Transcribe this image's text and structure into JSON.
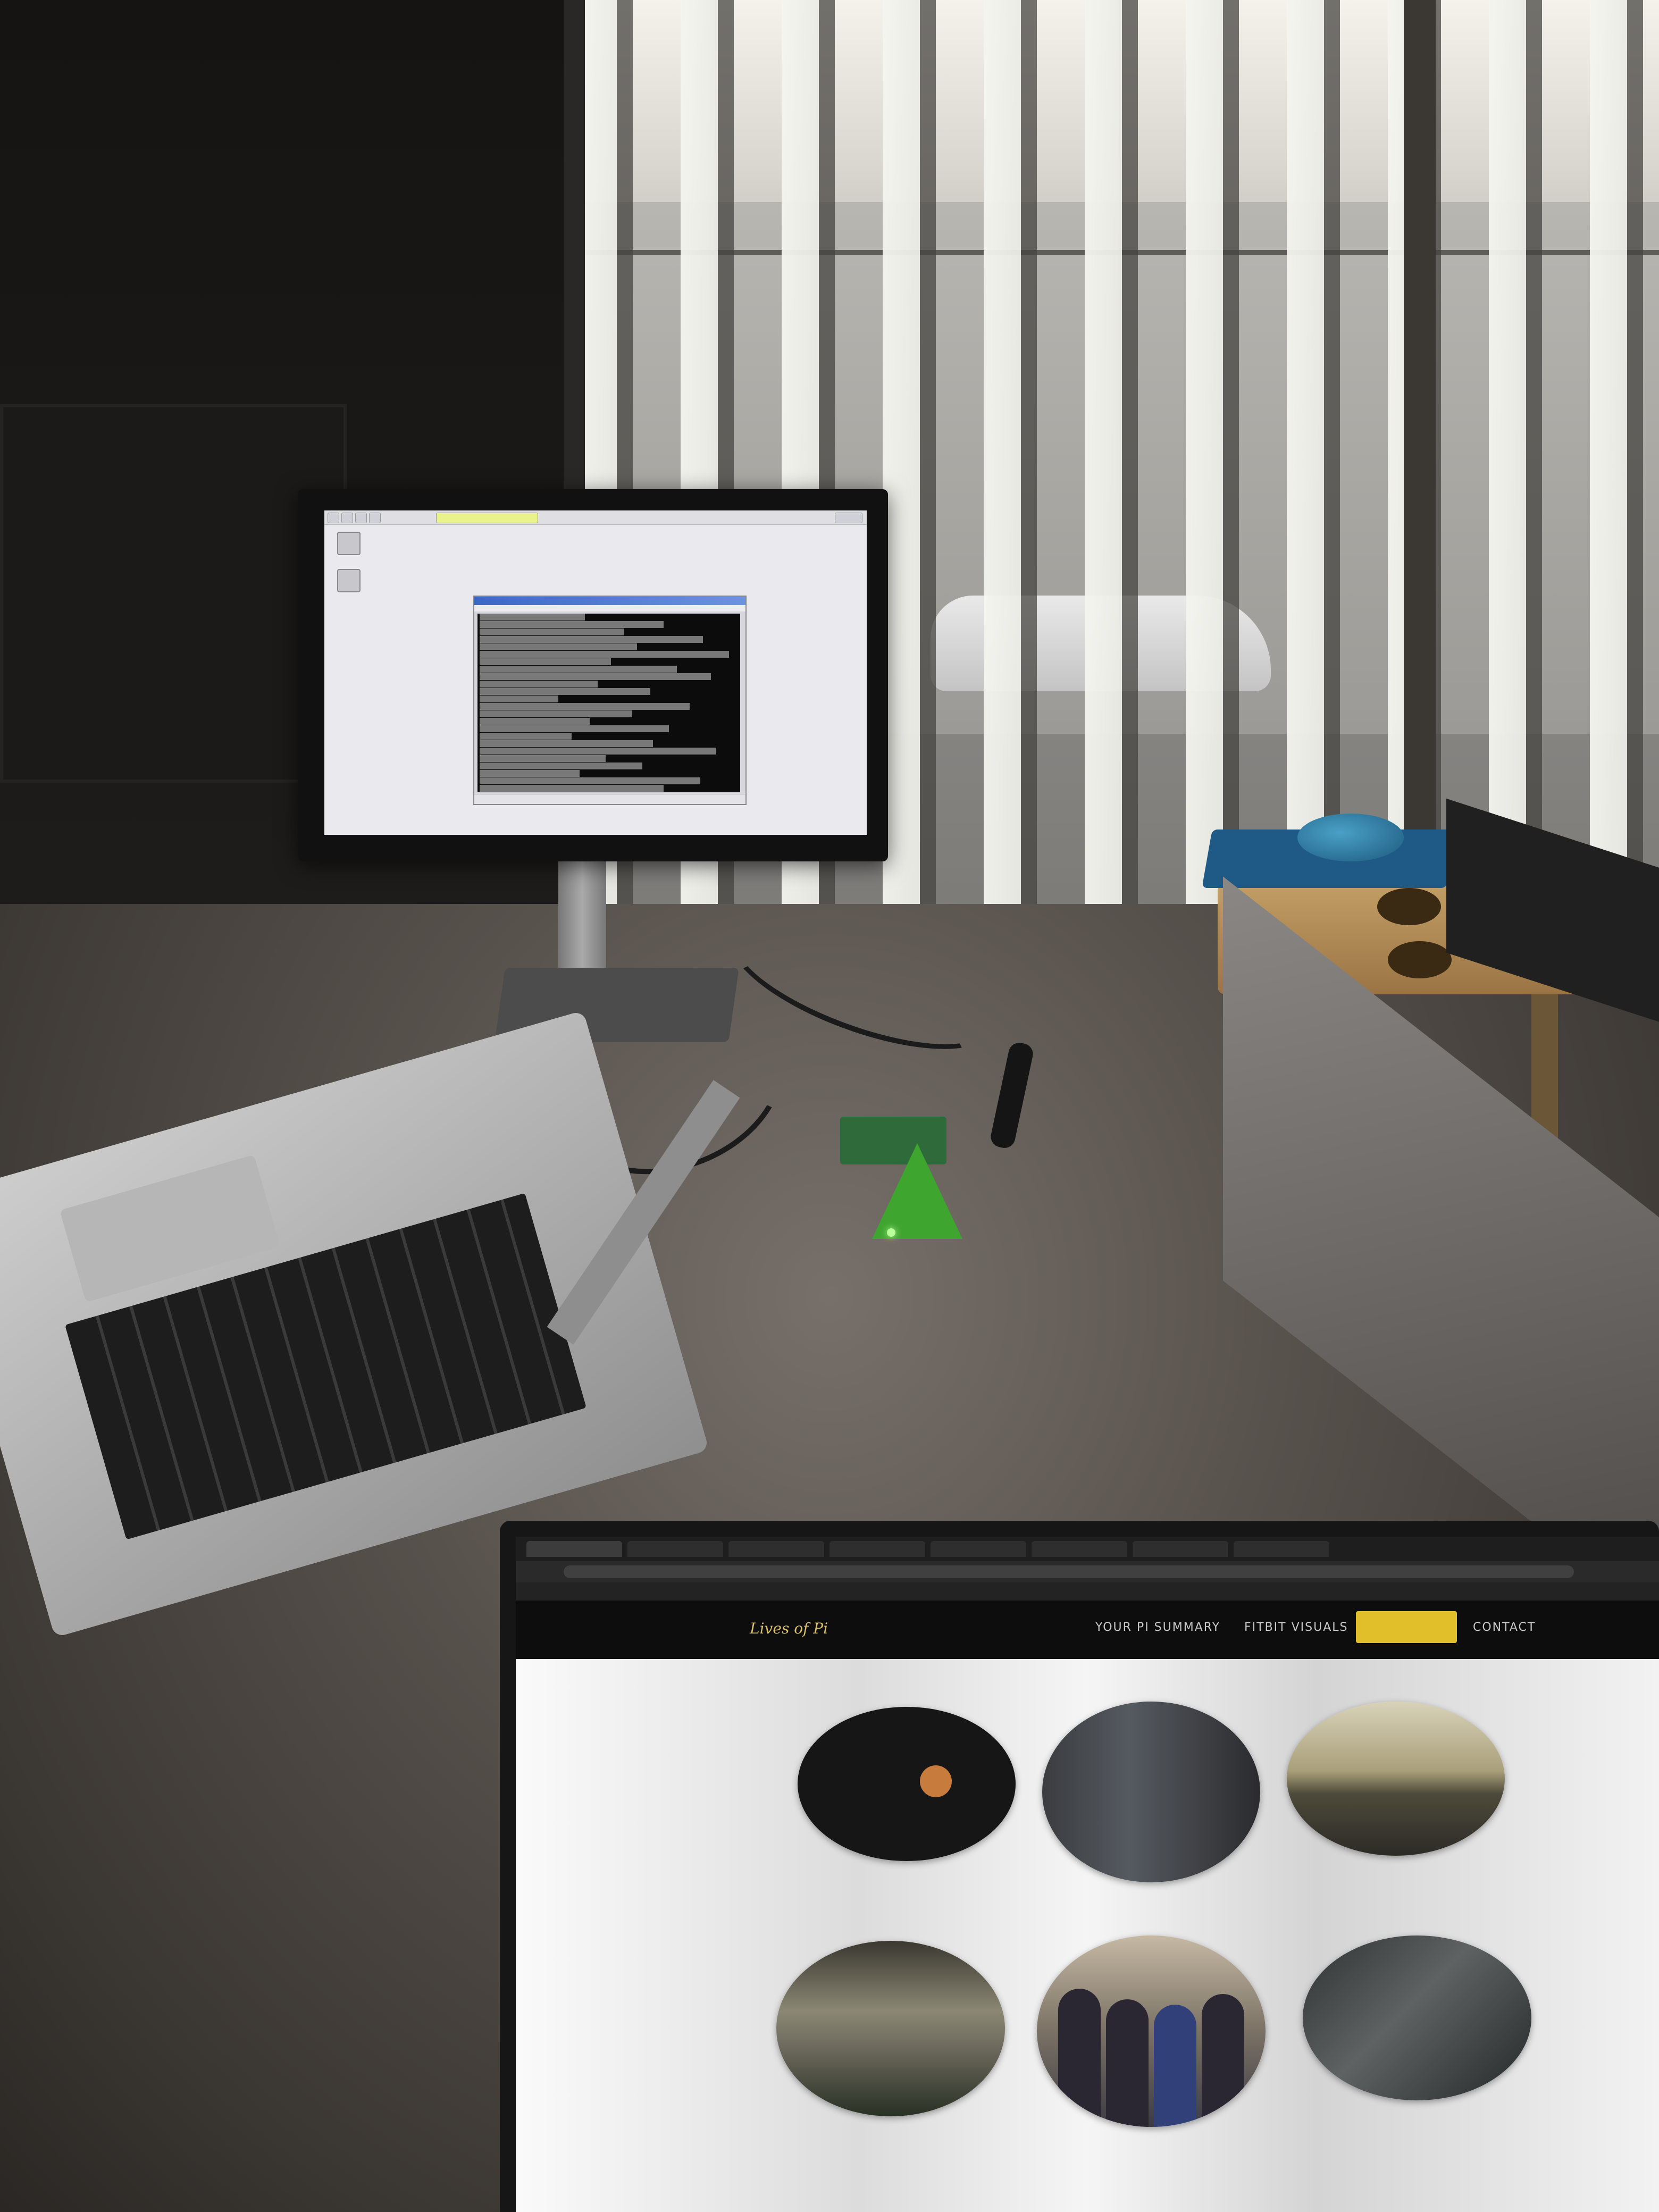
{
  "scene": {
    "description_tag": "",
    "accent_colors": {
      "site_nav_active": "#e0bf2a",
      "pi_case": "#3ea52f",
      "mousepad": "#1f5a86"
    }
  },
  "monitor": {
    "os_taskbar_items": [
      "menu",
      "browser",
      "files",
      "terminal",
      "active-window"
    ],
    "desktop_icons": [
      {
        "icon": "wastebasket-icon"
      },
      {
        "icon": "folder-icon"
      }
    ],
    "terminal_line_count": 28
  },
  "website": {
    "browser_tab_count": 8,
    "logo_text": "Lives of Pi",
    "nav": [
      {
        "label": "YOUR PI SUMMARY"
      },
      {
        "label": "FITBIT VISUALS"
      },
      {
        "label": ""
      },
      {
        "label": "CONTACT"
      }
    ],
    "gallery_photos": [
      {
        "subject": "moon"
      },
      {
        "subject": "room"
      },
      {
        "subject": "sunset"
      },
      {
        "subject": "fog"
      },
      {
        "subject": "people"
      },
      {
        "subject": "car"
      }
    ]
  }
}
